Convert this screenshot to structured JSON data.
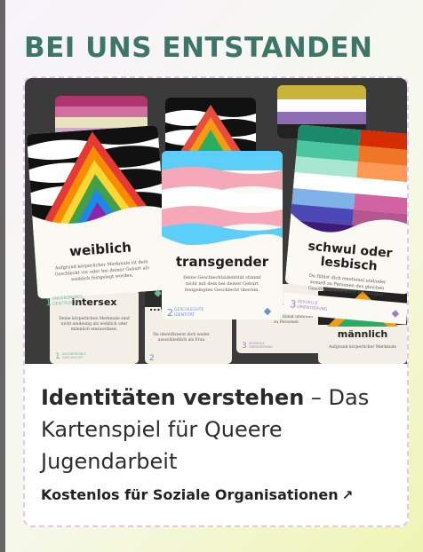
{
  "headline": "BEI UNS ENTSTANDEN",
  "card": {
    "title_bold": "Identitäten verstehen",
    "title_rest": " – Das Kartenspiel für Queere Jugendarbeit",
    "cta_label": "Kostenlos für Soziale Organisationen",
    "cta_icon": "arrow-up-right-icon",
    "cta_arrow": "↗"
  },
  "cards_image": {
    "front": [
      {
        "title": "weiblich",
        "text": "Aufgrund körperlicher Merkmale ist dein Geschlecht vor oder bei deiner Geburt als weiblich festgelegt worden.",
        "num": "1",
        "category": "ANGEBORENES GESCHLECHT"
      },
      {
        "title": "transgender",
        "text": "Deine Geschlechtsidentität stimmt nicht mit dem bei deiner Geburt festgelegten Geschlecht überein.",
        "num": "2",
        "category": "GESCHLECHTS IDENTITÄT"
      },
      {
        "title": "schwul oder lesbisch",
        "title_line1": "schwul oder",
        "title_line2": "lesbisch",
        "text": "Du fühlst dich emotional und/oder sexuell zu Personen des gleichen Geschlechts/Identität hingezogen.",
        "num": "3",
        "category": "SEXUELLE ORIENTIERUNG"
      }
    ],
    "back": [
      {
        "title": "intersex",
        "text": "Deine körperlichen Merkmale sind nicht eindeutig als weiblich oder männlich einzuordnen.",
        "num": "1",
        "category": "ANGEBORENES GESCHLECHT"
      },
      {
        "title": "...ueil",
        "num": "3",
        "category": "SEXUELLE ORIENTIERUNG"
      },
      {
        "title": "männlich",
        "text": "Aufgrund körperlicher Merkmale"
      }
    ],
    "colors": {
      "trans_blue": "#5bcefa",
      "trans_pink": "#f5a9b8",
      "green_accent": "#6fb59b",
      "purple_accent": "#9b7fc9",
      "headline": "#3e7569"
    }
  }
}
